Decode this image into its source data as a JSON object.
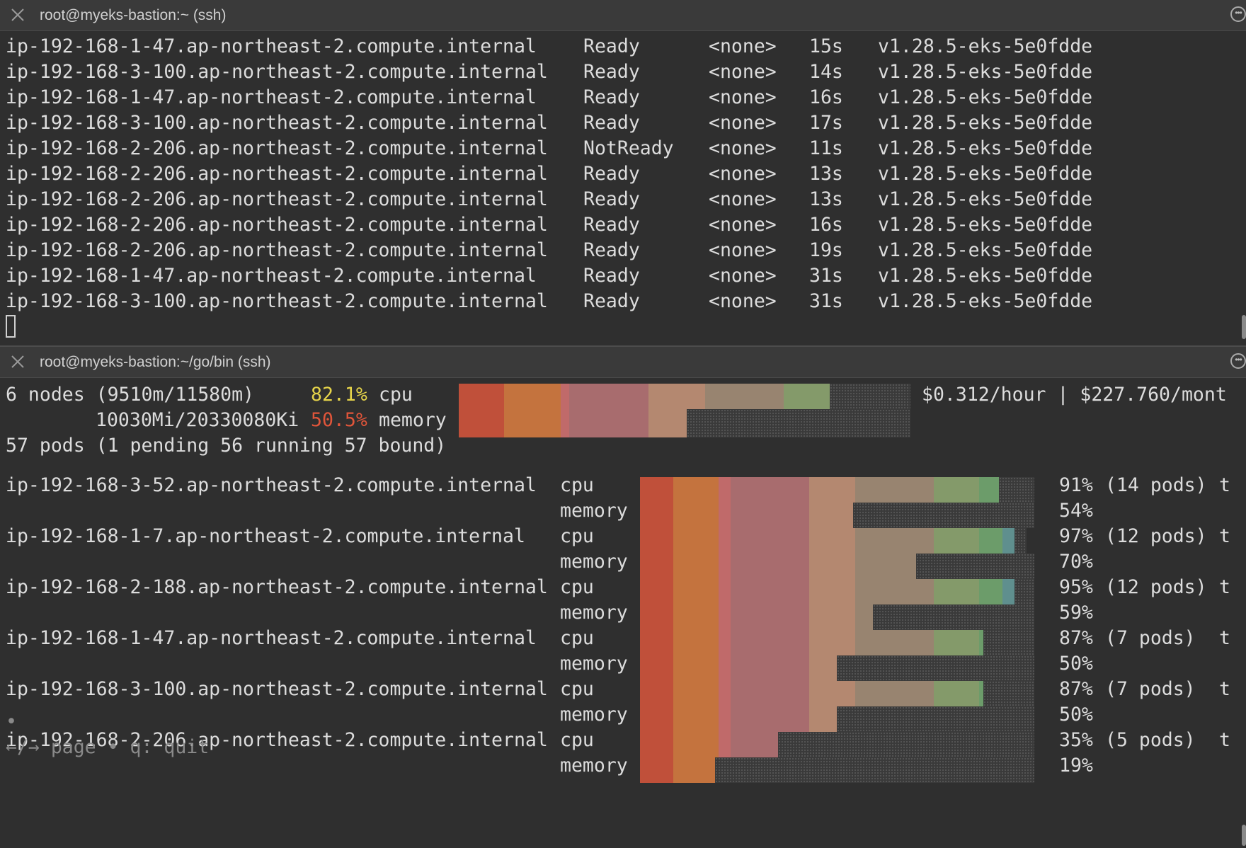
{
  "top_pane": {
    "title": "root@myeks-bastion:~ (ssh)",
    "rows": [
      {
        "name": "ip-192-168-1-47.ap-northeast-2.compute.internal",
        "status": "Ready",
        "roles": "<none>",
        "age": "15s",
        "version": "v1.28.5-eks-5e0fdde"
      },
      {
        "name": "ip-192-168-3-100.ap-northeast-2.compute.internal",
        "status": "Ready",
        "roles": "<none>",
        "age": "14s",
        "version": "v1.28.5-eks-5e0fdde"
      },
      {
        "name": "ip-192-168-1-47.ap-northeast-2.compute.internal",
        "status": "Ready",
        "roles": "<none>",
        "age": "16s",
        "version": "v1.28.5-eks-5e0fdde"
      },
      {
        "name": "ip-192-168-3-100.ap-northeast-2.compute.internal",
        "status": "Ready",
        "roles": "<none>",
        "age": "17s",
        "version": "v1.28.5-eks-5e0fdde"
      },
      {
        "name": "ip-192-168-2-206.ap-northeast-2.compute.internal",
        "status": "NotReady",
        "roles": "<none>",
        "age": "11s",
        "version": "v1.28.5-eks-5e0fdde"
      },
      {
        "name": "ip-192-168-2-206.ap-northeast-2.compute.internal",
        "status": "Ready",
        "roles": "<none>",
        "age": "13s",
        "version": "v1.28.5-eks-5e0fdde"
      },
      {
        "name": "ip-192-168-2-206.ap-northeast-2.compute.internal",
        "status": "Ready",
        "roles": "<none>",
        "age": "13s",
        "version": "v1.28.5-eks-5e0fdde"
      },
      {
        "name": "ip-192-168-2-206.ap-northeast-2.compute.internal",
        "status": "Ready",
        "roles": "<none>",
        "age": "16s",
        "version": "v1.28.5-eks-5e0fdde"
      },
      {
        "name": "ip-192-168-2-206.ap-northeast-2.compute.internal",
        "status": "Ready",
        "roles": "<none>",
        "age": "19s",
        "version": "v1.28.5-eks-5e0fdde"
      },
      {
        "name": "ip-192-168-1-47.ap-northeast-2.compute.internal",
        "status": "Ready",
        "roles": "<none>",
        "age": "31s",
        "version": "v1.28.5-eks-5e0fdde"
      },
      {
        "name": "ip-192-168-3-100.ap-northeast-2.compute.internal",
        "status": "Ready",
        "roles": "<none>",
        "age": "31s",
        "version": "v1.28.5-eks-5e0fdde"
      }
    ]
  },
  "bottom_pane": {
    "title": "root@myeks-bastion:~/go/bin (ssh)",
    "summary": {
      "nodes_label": "6 nodes (9510m/11580m)",
      "cpu_pct": "82.1%",
      "cpu_label": "cpu",
      "mem_detail": "10030Mi/20330080Ki",
      "mem_pct": "50.5%",
      "mem_label": "memory",
      "pods_label": "57 pods (1 pending 56 running 57 bound)",
      "cost": "$0.312/hour | $227.760/mont",
      "cpu_fraction": 0.821,
      "mem_fraction": 0.505
    },
    "nodes": [
      {
        "name": "ip-192-168-3-52.ap-northeast-2.compute.internal",
        "cpu_label": "cpu",
        "mem_label": "memory",
        "cpu_pct": "91%",
        "cpu_info": "(14 pods)",
        "trail": "t",
        "mem_pct": "54%",
        "cpu_fraction": 0.91,
        "mem_fraction": 0.54
      },
      {
        "name": "ip-192-168-1-7.ap-northeast-2.compute.internal",
        "cpu_label": "cpu",
        "mem_label": "memory",
        "cpu_pct": "97%",
        "cpu_info": "(12 pods)",
        "trail": "t",
        "mem_pct": "70%",
        "cpu_fraction": 0.97,
        "mem_fraction": 0.7
      },
      {
        "name": "ip-192-168-2-188.ap-northeast-2.compute.internal",
        "cpu_label": "cpu",
        "mem_label": "memory",
        "cpu_pct": "95%",
        "cpu_info": "(12 pods)",
        "trail": "t",
        "mem_pct": "59%",
        "cpu_fraction": 0.95,
        "mem_fraction": 0.59
      },
      {
        "name": "ip-192-168-1-47.ap-northeast-2.compute.internal",
        "cpu_label": "cpu",
        "mem_label": "memory",
        "cpu_pct": "87%",
        "cpu_info": "(7 pods)",
        "trail": "t",
        "mem_pct": "50%",
        "cpu_fraction": 0.87,
        "mem_fraction": 0.5
      },
      {
        "name": "ip-192-168-3-100.ap-northeast-2.compute.internal",
        "cpu_label": "cpu",
        "mem_label": "memory",
        "cpu_pct": "87%",
        "cpu_info": "(7 pods)",
        "trail": "t",
        "mem_pct": "50%",
        "cpu_fraction": 0.87,
        "mem_fraction": 0.5
      },
      {
        "name": "ip-192-168-2-206.ap-northeast-2.compute.internal",
        "cpu_label": "cpu",
        "mem_label": "memory",
        "cpu_pct": "35%",
        "cpu_info": "(5 pods)",
        "trail": "t",
        "mem_pct": "19%",
        "cpu_fraction": 0.35,
        "mem_fraction": 0.19
      }
    ],
    "bullet": "•",
    "footer": "←/→ page • q: quit"
  },
  "colors": {
    "segments": [
      "#c0503a",
      "#c4733e",
      "#c06a6a",
      "#a86c6e",
      "#b48870",
      "#988470",
      "#849a6a",
      "#6c9c6a",
      "#5f8f8e"
    ],
    "cpu_pct_color": "#e6d44a",
    "mem_pct_color": "#e0553a"
  }
}
